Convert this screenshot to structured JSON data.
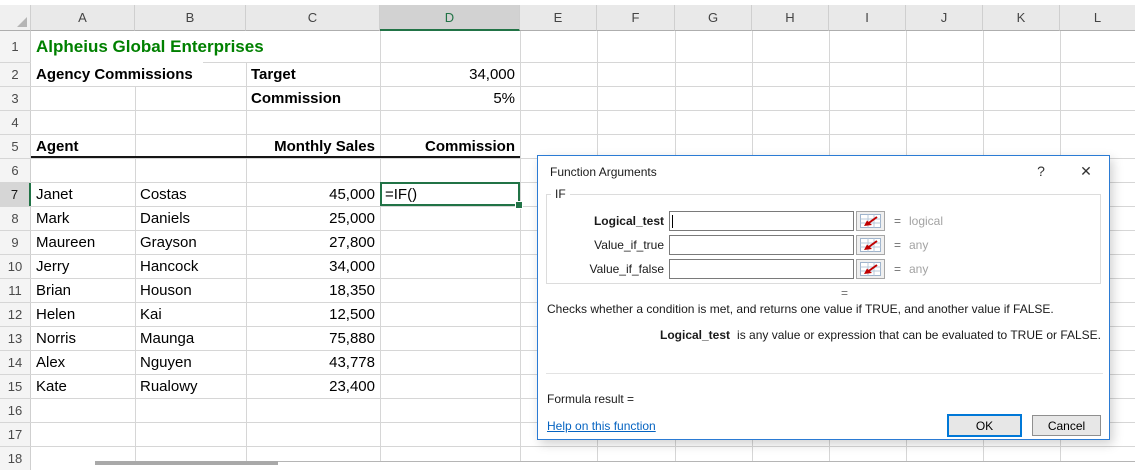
{
  "spreadsheet": {
    "column_labels": [
      "A",
      "B",
      "C",
      "D",
      "E",
      "F",
      "G",
      "H",
      "I",
      "J",
      "K",
      "L"
    ],
    "row_labels": [
      "1",
      "2",
      "3",
      "4",
      "5",
      "6",
      "7",
      "8",
      "9",
      "10",
      "11",
      "12",
      "13",
      "14",
      "15",
      "16",
      "17",
      "18"
    ],
    "selection": {
      "cell": "D7",
      "column": "D",
      "row": "7"
    },
    "accent_green": "#217346",
    "title_color": "#008000",
    "cells": [
      {
        "r": "1",
        "c": "A",
        "text": "Alpheius Global Enterprises",
        "bold": true,
        "color": "#008000",
        "overflow": true,
        "title": true
      },
      {
        "r": "2",
        "c": "A",
        "text": "Agency Commissions",
        "bold": true,
        "overflow": true
      },
      {
        "r": "2",
        "c": "C",
        "text": "Target",
        "bold": true
      },
      {
        "r": "2",
        "c": "D",
        "text": "34,000",
        "align": "right"
      },
      {
        "r": "3",
        "c": "C",
        "text": "Commission",
        "bold": true
      },
      {
        "r": "3",
        "c": "D",
        "text": "5%",
        "align": "right"
      },
      {
        "r": "5",
        "c": "A",
        "text": "Agent",
        "bold": true
      },
      {
        "r": "5",
        "c": "C",
        "text": "Monthly Sales",
        "bold": true,
        "align": "right"
      },
      {
        "r": "5",
        "c": "D",
        "text": "Commission",
        "bold": true,
        "align": "right"
      },
      {
        "r": "7",
        "c": "A",
        "text": "Janet"
      },
      {
        "r": "7",
        "c": "B",
        "text": "Costas"
      },
      {
        "r": "7",
        "c": "C",
        "text": "45,000",
        "align": "right"
      },
      {
        "r": "7",
        "c": "D",
        "text": "=IF()"
      },
      {
        "r": "8",
        "c": "A",
        "text": "Mark"
      },
      {
        "r": "8",
        "c": "B",
        "text": "Daniels"
      },
      {
        "r": "8",
        "c": "C",
        "text": "25,000",
        "align": "right"
      },
      {
        "r": "9",
        "c": "A",
        "text": "Maureen"
      },
      {
        "r": "9",
        "c": "B",
        "text": "Grayson"
      },
      {
        "r": "9",
        "c": "C",
        "text": "27,800",
        "align": "right"
      },
      {
        "r": "10",
        "c": "A",
        "text": "Jerry"
      },
      {
        "r": "10",
        "c": "B",
        "text": "Hancock"
      },
      {
        "r": "10",
        "c": "C",
        "text": "34,000",
        "align": "right"
      },
      {
        "r": "11",
        "c": "A",
        "text": "Brian"
      },
      {
        "r": "11",
        "c": "B",
        "text": "Houson"
      },
      {
        "r": "11",
        "c": "C",
        "text": "18,350",
        "align": "right"
      },
      {
        "r": "12",
        "c": "A",
        "text": "Helen"
      },
      {
        "r": "12",
        "c": "B",
        "text": "Kai"
      },
      {
        "r": "12",
        "c": "C",
        "text": "12,500",
        "align": "right"
      },
      {
        "r": "13",
        "c": "A",
        "text": "Norris"
      },
      {
        "r": "13",
        "c": "B",
        "text": "Maunga"
      },
      {
        "r": "13",
        "c": "C",
        "text": "75,880",
        "align": "right"
      },
      {
        "r": "14",
        "c": "A",
        "text": "Alex"
      },
      {
        "r": "14",
        "c": "B",
        "text": "Nguyen"
      },
      {
        "r": "14",
        "c": "C",
        "text": "43,778",
        "align": "right"
      },
      {
        "r": "15",
        "c": "A",
        "text": "Kate"
      },
      {
        "r": "15",
        "c": "B",
        "text": "Rualowy"
      },
      {
        "r": "15",
        "c": "C",
        "text": "23,400",
        "align": "right"
      }
    ]
  },
  "dialog": {
    "title": "Function Arguments",
    "help_button": "?",
    "close_button": "✕",
    "function_name": "IF",
    "equals_sign": "=",
    "fields": [
      {
        "label": "Logical_test",
        "value": "",
        "type": "logical"
      },
      {
        "label": "Value_if_true",
        "value": "",
        "type": "any"
      },
      {
        "label": "Value_if_false",
        "value": "",
        "type": "any"
      }
    ],
    "description": "Checks whether a condition is met, and returns one value if TRUE, and another value if FALSE.",
    "arg_help_name": "Logical_test",
    "arg_help_text": "is any value or expression that can be evaluated to TRUE or FALSE.",
    "formula_result_label": "Formula result =",
    "help_link": "Help on this function",
    "ok_label": "OK",
    "cancel_label": "Cancel",
    "accent_blue": "#0078d7",
    "link_color": "#0563c1"
  }
}
